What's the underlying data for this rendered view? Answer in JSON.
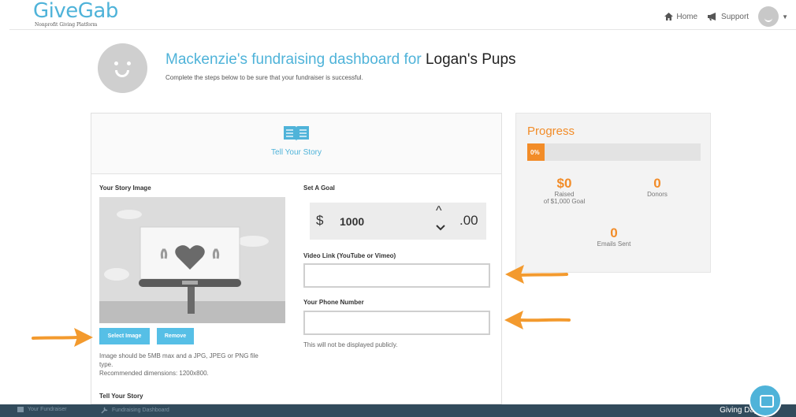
{
  "topbar": {
    "logo": "GiveGab",
    "logo_sub": "Nonprofit Giving Platform",
    "nav": {
      "home": "Home",
      "support": "Support"
    }
  },
  "header": {
    "title_part1": "Mackenzie's fundraising dashboard for",
    "title_org": "Logan's Pups",
    "subtitle": "Complete the steps below to be sure that your fundraiser is successful."
  },
  "card": {
    "section_title": "Tell Your Story",
    "story_image_label": "Your Story Image",
    "select_image_label": "Select Image",
    "remove_label": "Remove",
    "image_help_1": "Image should be 5MB max and a JPG, JPEG or PNG file",
    "image_help_2": "type.",
    "image_help_3": "Recommended dimensions: 1200x800.",
    "tell_story_label": "Tell Your Story",
    "goal_label": "Set A Goal",
    "goal_currency": "$",
    "goal_value": "1000",
    "goal_decimal": ".00",
    "video_label": "Video Link (YouTube or Vimeo)",
    "phone_label": "Your Phone Number",
    "phone_help": "This will not be displayed publicly."
  },
  "progress": {
    "title": "Progress",
    "percent_label": "0%",
    "percent_value": 0,
    "raised_amount": "$0",
    "raised_label": "Raised",
    "raised_sub": "of $1,000 Goal",
    "donors_count": "0",
    "donors_label": "Donors",
    "emails_count": "0",
    "emails_label": "Emails Sent"
  },
  "bottombar": {
    "item1": "Your Fundraiser",
    "item2": "Fundraising Dashboard",
    "right": "Giving Day"
  },
  "colors": {
    "accent": "#4fb3d9",
    "orange": "#f28c28",
    "bottombar": "#324b5c"
  }
}
